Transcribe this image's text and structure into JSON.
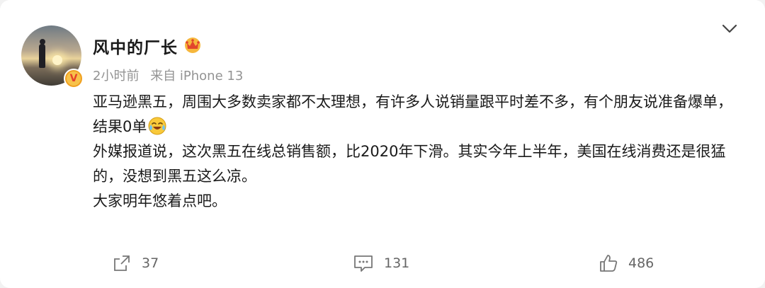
{
  "post": {
    "username": "风中的厂长",
    "time": "2小时前",
    "source": "来自 iPhone 13",
    "verified_badge": "V",
    "paragraphs": [
      "亚马逊黑五，周围大多数卖家都不太理想，有许多人说销量跟平时差不多，有个朋友说准备爆单，结果0单",
      "外媒报道说，这次黑五在线总销售额，比2020年下滑。其实今年上半年，美国在线消费还是很猛的，没想到黑五这么凉。",
      "大家明年悠着点吧。"
    ],
    "emoji": "laugh-cry-emoji"
  },
  "actions": {
    "share_count": "37",
    "comment_count": "131",
    "like_count": "486"
  },
  "colors": {
    "username": "#1a1a1a",
    "meta": "#939393",
    "action": "#666666",
    "badge": "#f0a020"
  }
}
